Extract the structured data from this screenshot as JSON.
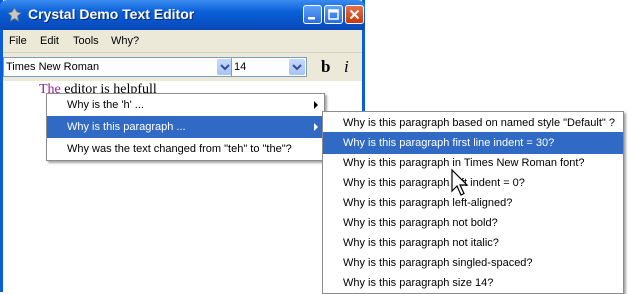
{
  "window": {
    "title": "Crystal Demo Text Editor"
  },
  "menubar": {
    "items": [
      "File",
      "Edit",
      "Tools",
      "Why?"
    ]
  },
  "toolbar": {
    "font_value": "Times New Roman",
    "size_value": "14",
    "bold_label": "b",
    "italic_label": "i"
  },
  "document": {
    "first": "The",
    "rest": " editor is helpfull"
  },
  "context_menu": {
    "items": [
      {
        "label": "Why is the 'h' ..."
      },
      {
        "label": "Why is this paragraph ..."
      },
      {
        "label": "Why was the text changed from \"teh\" to \"the\"?"
      }
    ]
  },
  "submenu": {
    "items": [
      "Why is this paragraph based on named style \"Default\" ?",
      "Why is this paragraph first line indent = 30?",
      "Why is this paragraph in Times New Roman font?",
      "Why is this paragraph left indent = 0?",
      "Why is this paragraph left-aligned?",
      "Why is this paragraph not bold?",
      "Why is this paragraph not italic?",
      "Why is this paragraph singled-spaced?",
      "Why is this paragraph size 14?"
    ]
  },
  "colors": {
    "titlebar": "#0a5fd8",
    "highlight": "#316ac5"
  }
}
